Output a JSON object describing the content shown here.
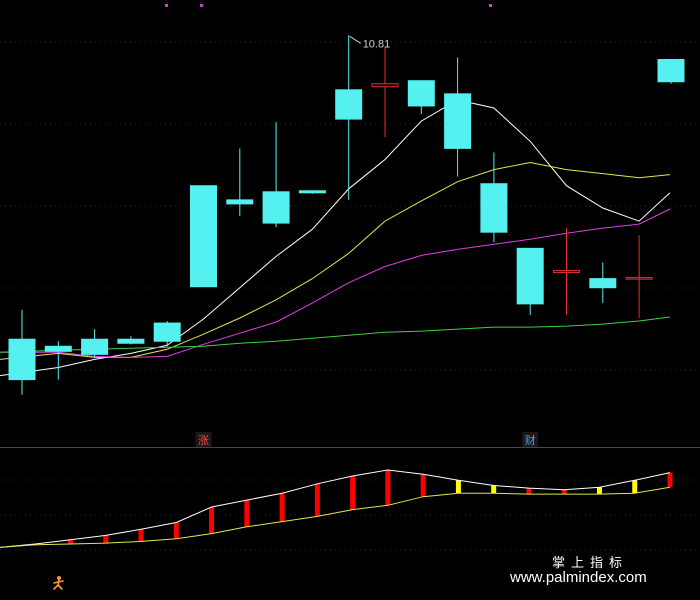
{
  "chart_data": [
    {
      "type": "candlestick",
      "panel": "main",
      "high_label": "10.81",
      "candles": [
        {
          "o": 7.8,
          "h": 8.09,
          "l": 7.25,
          "c": 7.4
        },
        {
          "o": 7.73,
          "h": 7.78,
          "l": 7.4,
          "c": 7.68
        },
        {
          "o": 7.8,
          "h": 7.9,
          "l": 7.62,
          "c": 7.65
        },
        {
          "o": 7.8,
          "h": 7.83,
          "l": 7.75,
          "c": 7.76
        },
        {
          "o": 7.96,
          "h": 7.98,
          "l": 7.73,
          "c": 7.78
        },
        {
          "o": 9.32,
          "h": 9.32,
          "l": 8.32,
          "c": 8.32
        },
        {
          "o": 9.18,
          "h": 9.69,
          "l": 9.02,
          "c": 9.14
        },
        {
          "o": 9.26,
          "h": 9.95,
          "l": 8.91,
          "c": 8.95
        },
        {
          "o": 9.27,
          "h": 9.27,
          "l": 9.24,
          "c": 9.25
        },
        {
          "o": 10.27,
          "h": 10.81,
          "l": 9.18,
          "c": 9.98
        },
        {
          "o": 10.3,
          "h": 10.7,
          "l": 9.8,
          "c": 10.33
        },
        {
          "o": 10.36,
          "h": 10.36,
          "l": 10.03,
          "c": 10.11
        },
        {
          "o": 10.23,
          "h": 10.59,
          "l": 9.41,
          "c": 9.69
        },
        {
          "o": 9.34,
          "h": 9.65,
          "l": 8.76,
          "c": 8.86
        },
        {
          "o": 8.7,
          "h": 8.7,
          "l": 8.04,
          "c": 8.15
        },
        {
          "o": 8.46,
          "h": 8.9,
          "l": 8.04,
          "c": 8.48
        },
        {
          "o": 8.4,
          "h": 8.56,
          "l": 8.16,
          "c": 8.31
        },
        {
          "o": 8.41,
          "h": 8.83,
          "l": 8.01,
          "c": 8.41
        },
        {
          "o": 10.57,
          "h": 10.57,
          "l": 10.33,
          "c": 10.35
        }
      ],
      "ma_lines": [
        {
          "color": "#ffffff",
          "values": [
            7.44,
            7.52,
            7.6,
            7.66,
            7.74,
            8.0,
            8.31,
            8.62,
            8.89,
            9.29,
            9.58,
            9.96,
            10.17,
            10.09,
            9.76,
            9.32,
            9.1,
            8.97,
            9.25
          ]
        },
        {
          "color": "#e6e64c",
          "values": [
            7.6,
            7.66,
            7.62,
            7.62,
            7.7,
            7.85,
            8.01,
            8.19,
            8.4,
            8.65,
            8.97,
            9.17,
            9.36,
            9.48,
            9.55,
            9.48,
            9.44,
            9.4,
            9.43
          ]
        },
        {
          "color": "#e040e0",
          "values": [
            7.67,
            7.67,
            7.63,
            7.62,
            7.63,
            7.75,
            7.86,
            7.97,
            8.16,
            8.36,
            8.52,
            8.63,
            8.69,
            8.74,
            8.79,
            8.85,
            8.9,
            8.94,
            9.09
          ]
        },
        {
          "color": "#40d040",
          "values": [
            7.67,
            7.69,
            7.7,
            7.71,
            7.72,
            7.73,
            7.76,
            7.78,
            7.81,
            7.84,
            7.87,
            7.88,
            7.9,
            7.92,
            7.92,
            7.93,
            7.95,
            7.98,
            8.02
          ]
        }
      ],
      "signals": [
        {
          "index": 5,
          "label": "涨",
          "color": "#ff4040"
        },
        {
          "index": 14,
          "label": "财",
          "color": "#40a0ff"
        }
      ]
    },
    {
      "type": "indicator",
      "panel": "sub",
      "upper": [
        0.1,
        0.14,
        0.19,
        0.24,
        0.31,
        0.39,
        0.57,
        0.65,
        0.73,
        0.84,
        0.93,
        1.0,
        0.95,
        0.88,
        0.82,
        0.79,
        0.77,
        0.8,
        0.88,
        0.97
      ],
      "lower": [
        0.1,
        0.13,
        0.14,
        0.15,
        0.17,
        0.2,
        0.26,
        0.34,
        0.4,
        0.46,
        0.54,
        0.59,
        0.69,
        0.73,
        0.73,
        0.72,
        0.72,
        0.72,
        0.73,
        0.8
      ],
      "bar_colors": [
        "red",
        "red",
        "red",
        "red",
        "red",
        "red",
        "red",
        "red",
        "red",
        "red",
        "red",
        "red",
        "red",
        "yellow",
        "yellow",
        "red",
        "red",
        "yellow",
        "yellow",
        "red"
      ]
    }
  ],
  "watermark": {
    "title": "掌上指标",
    "url": "www.palmindex.com"
  },
  "colors": {
    "background": "#000000",
    "up": "#e83030",
    "down": "#55f0f0",
    "grid": "#2a2a2a",
    "separator": "#8a2a2a",
    "bar_red": "#ff0000",
    "bar_yellow": "#ffff00"
  },
  "icons": {
    "sub_panel_corner": "running-figure-icon",
    "high_marker": "arrow-marker-icon"
  }
}
